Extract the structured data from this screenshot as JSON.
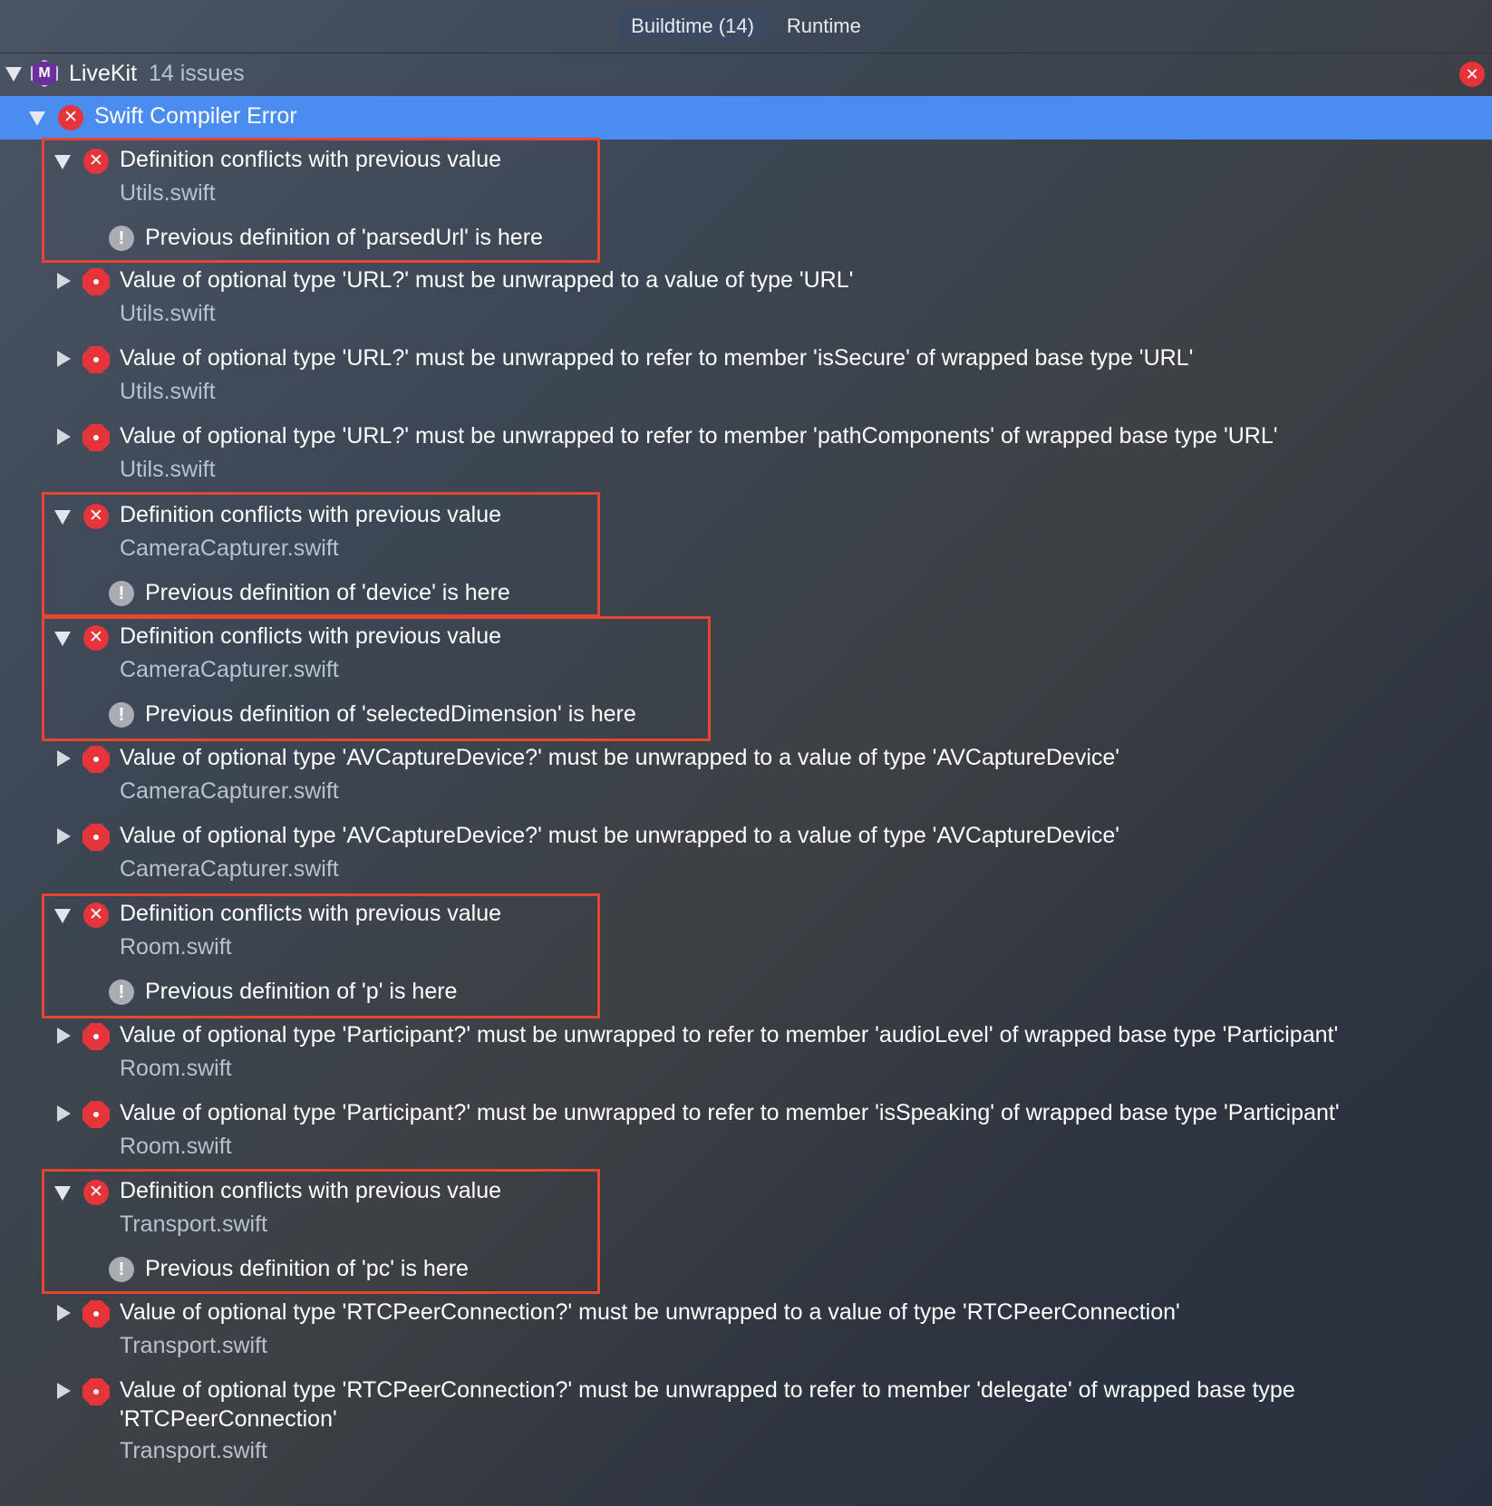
{
  "tabs": {
    "buildtime": "Buildtime (14)",
    "runtime": "Runtime"
  },
  "project": {
    "name": "LiveKit",
    "issue_count": "14 issues",
    "icon": "M"
  },
  "group": {
    "title": "Swift Compiler Error"
  },
  "issues": [
    {
      "message": "Definition conflicts with previous value",
      "file": "Utils.swift",
      "note": "Previous definition of 'parsedUrl' is here"
    },
    {
      "message": "Value of optional type 'URL?' must be unwrapped to a value of type 'URL'",
      "file": "Utils.swift"
    },
    {
      "message": "Value of optional type 'URL?' must be unwrapped to refer to member 'isSecure' of wrapped base type 'URL'",
      "file": "Utils.swift"
    },
    {
      "message": "Value of optional type 'URL?' must be unwrapped to refer to member 'pathComponents' of wrapped base type 'URL'",
      "file": "Utils.swift"
    },
    {
      "message": "Definition conflicts with previous value",
      "file": "CameraCapturer.swift",
      "note": "Previous definition of 'device' is here"
    },
    {
      "message": "Definition conflicts with previous value",
      "file": "CameraCapturer.swift",
      "note": "Previous definition of 'selectedDimension' is here"
    },
    {
      "message": "Value of optional type 'AVCaptureDevice?' must be unwrapped to a value of type 'AVCaptureDevice'",
      "file": "CameraCapturer.swift"
    },
    {
      "message": "Value of optional type 'AVCaptureDevice?' must be unwrapped to a value of type 'AVCaptureDevice'",
      "file": "CameraCapturer.swift"
    },
    {
      "message": "Definition conflicts with previous value",
      "file": "Room.swift",
      "note": "Previous definition of 'p' is here"
    },
    {
      "message": "Value of optional type 'Participant?' must be unwrapped to refer to member 'audioLevel' of wrapped base type 'Participant'",
      "file": "Room.swift"
    },
    {
      "message": "Value of optional type 'Participant?' must be unwrapped to refer to member 'isSpeaking' of wrapped base type 'Participant'",
      "file": "Room.swift"
    },
    {
      "message": "Definition conflicts with previous value",
      "file": "Transport.swift",
      "note": "Previous definition of 'pc' is here"
    },
    {
      "message": "Value of optional type 'RTCPeerConnection?' must be unwrapped to a value of type 'RTCPeerConnection'",
      "file": "Transport.swift"
    },
    {
      "message": "Value of optional type 'RTCPeerConnection?' must be unwrapped to refer to member 'delegate' of wrapped base type",
      "message_cont": "'RTCPeerConnection'",
      "file": "Transport.swift"
    }
  ],
  "colors": {
    "selection": "#4a8cf0",
    "error": "#e5343a",
    "highlight_box": "#e6452f",
    "file_text": "#b8c2cf"
  },
  "icons": {
    "error_expanded": "error-x-icon",
    "error_collapsed": "error-octagon-icon",
    "note": "exclamation-icon"
  }
}
